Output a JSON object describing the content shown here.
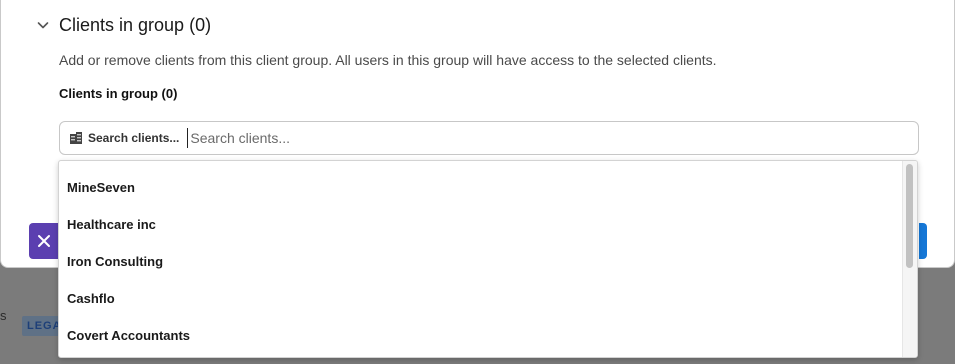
{
  "background": {
    "partial_text": "s",
    "badge_partial": "LEGA"
  },
  "section": {
    "title": "Clients in group (0)",
    "description": "Add or remove clients from this client group. All users in this group will have access to the selected clients.",
    "field_label": "Clients in group (0)"
  },
  "search": {
    "tag_label": "Search clients...",
    "placeholder": "Search clients..."
  },
  "dropdown": {
    "items": [
      {
        "label": "MineSeven"
      },
      {
        "label": "Healthcare inc"
      },
      {
        "label": "Iron Consulting"
      },
      {
        "label": "Cashflo"
      },
      {
        "label": "Covert Accountants"
      }
    ]
  },
  "icons": {
    "section_toggle": "chevron-down-icon",
    "search": "building-icon",
    "cancel": "close-icon"
  },
  "colors": {
    "cancel_button": "#5b3fb0",
    "confirm_button": "#1577d6",
    "legacy_badge_text": "#1d3f78"
  }
}
